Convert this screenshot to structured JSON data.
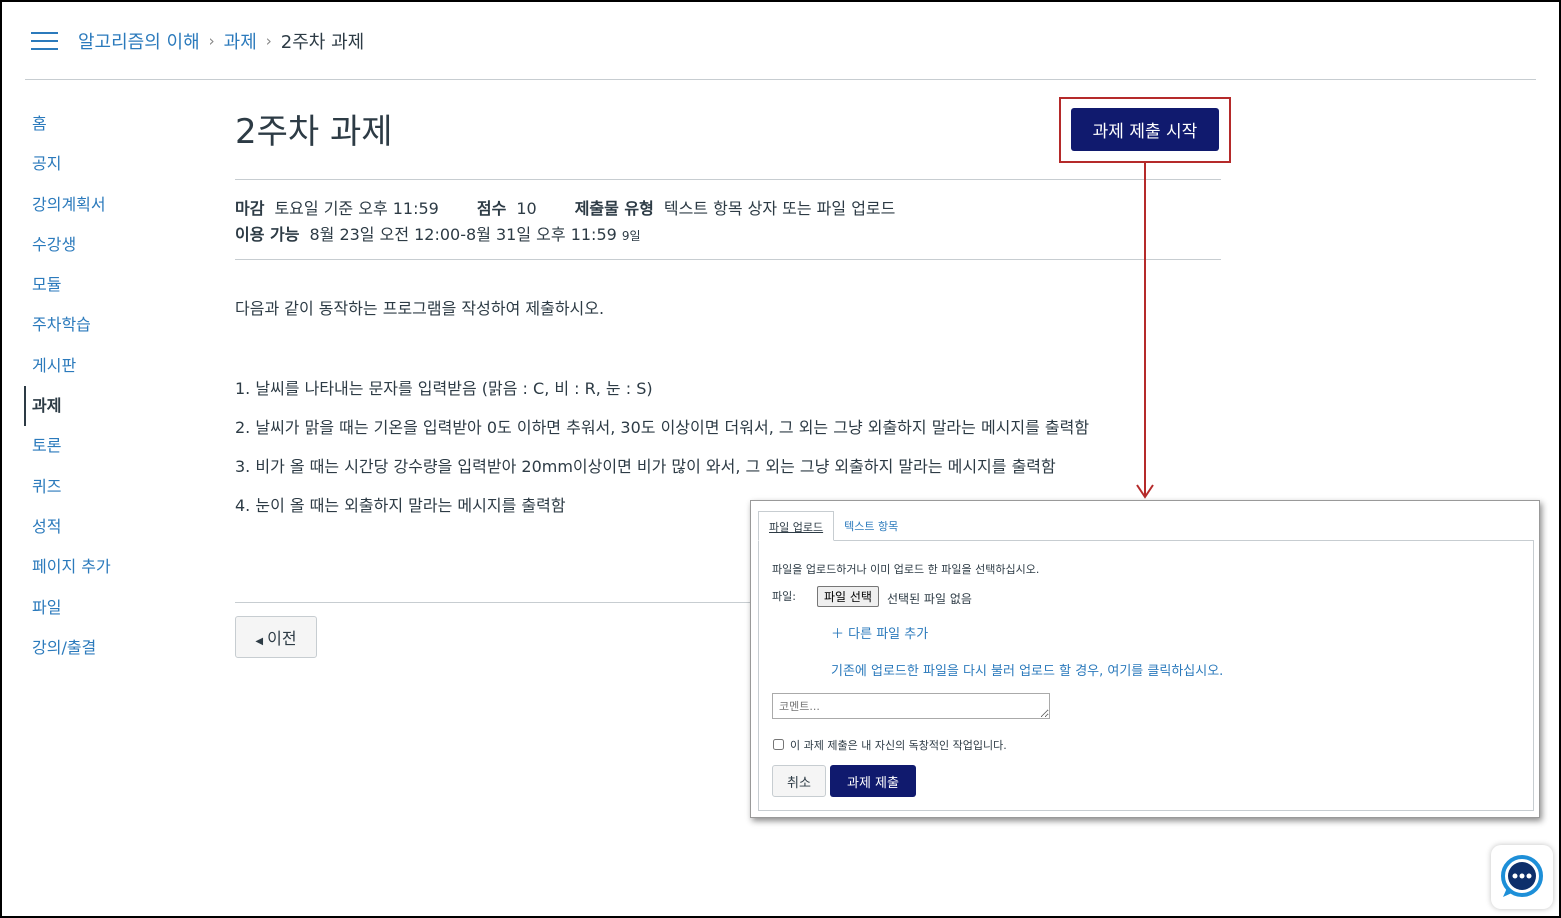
{
  "header": {
    "breadcrumbs": [
      "알고리즘의 이해",
      "과제",
      "2주차 과제"
    ],
    "separator": "›"
  },
  "sidebar": {
    "items": [
      {
        "label": "홈",
        "active": false
      },
      {
        "label": "공지",
        "active": false
      },
      {
        "label": "강의계획서",
        "active": false
      },
      {
        "label": "수강생",
        "active": false
      },
      {
        "label": "모듈",
        "active": false
      },
      {
        "label": "주차학습",
        "active": false
      },
      {
        "label": "게시판",
        "active": false
      },
      {
        "label": "과제",
        "active": true
      },
      {
        "label": "토론",
        "active": false
      },
      {
        "label": "퀴즈",
        "active": false
      },
      {
        "label": "성적",
        "active": false
      },
      {
        "label": "페이지 추가",
        "active": false
      },
      {
        "label": "파일",
        "active": false
      },
      {
        "label": "강의/출결",
        "active": false
      }
    ]
  },
  "assignment": {
    "title": "2주차 과제",
    "start_button": "과제 제출 시작",
    "due_label": "마감",
    "due_value": "토요일 기준 오후 11:59",
    "points_label": "점수",
    "points_value": "10",
    "type_label": "제출물 유형",
    "type_value": "텍스트 항목 상자 또는 파일 업로드",
    "available_label": "이용 가능",
    "available_value": "8월 23일 오전 12:00-8월 31일 오후 11:59",
    "available_days": "9일",
    "description": [
      "다음과 같이 동작하는 프로그램을 작성하여 제출하시오.",
      "1. 날씨를 나타내는 문자를 입력받음 (맑음 : C, 비 : R, 눈 : S)",
      "2. 날씨가 맑을 때는 기온을 입력받아 0도 이하면 추워서, 30도 이상이면 더워서, 그 외는 그냥 외출하지 말라는 메시지를 출력함",
      "3. 비가 올 때는 시간당 강수량을 입력받아 20mm이상이면 비가 많이 와서, 그 외는 그냥 외출하지 말라는 메시지를 출력함",
      "4. 눈이 올 때는 외출하지 말라는 메시지를 출력함"
    ],
    "prev_button": "이전"
  },
  "submission": {
    "tabs": [
      "파일 업로드",
      "텍스트 항목"
    ],
    "instructions": "파일을 업로드하거나 이미 업로드 한 파일을 선택하십시오.",
    "file_label": "파일:",
    "choose_file": "파일 선택",
    "no_file": "선택된 파일 없음",
    "add_file": "다른 파일 추가",
    "reupload_link": "기존에 업로드한 파일을 다시 불러 업로드 할 경우, 여기를 클릭하십시오.",
    "comment_placeholder": "코멘트...",
    "originality": "이 과제 제출은 내 자신의 독창적인 작업입니다.",
    "cancel": "취소",
    "submit": "과제 제출"
  },
  "colors": {
    "link": "#2b7abc",
    "primary_button": "#101a6e",
    "highlight_box": "#b52a2a",
    "text": "#2d3b45"
  }
}
